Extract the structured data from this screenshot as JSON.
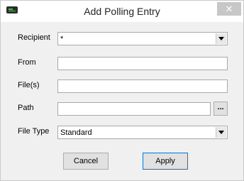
{
  "window": {
    "title": "Add Polling Entry",
    "close_glyph": "✕",
    "app_icon": "terminal-app-icon"
  },
  "form": {
    "recipient": {
      "label": "Recipient",
      "value": "*"
    },
    "from": {
      "label": "From",
      "value": ""
    },
    "files": {
      "label": "File(s)",
      "value": ""
    },
    "path": {
      "label": "Path",
      "value": "",
      "browse_label": "..."
    },
    "file_type": {
      "label": "File Type",
      "value": "Standard"
    }
  },
  "buttons": {
    "cancel": "Cancel",
    "apply": "Apply"
  }
}
